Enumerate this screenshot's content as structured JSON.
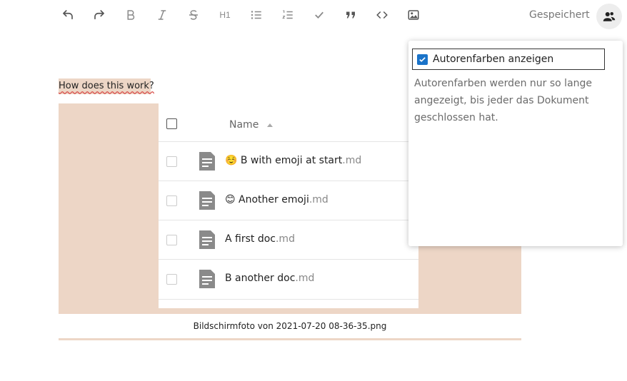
{
  "toolbar": {
    "heading_label": "H1",
    "status": "Gespeichert",
    "icons": [
      "undo-icon",
      "redo-icon",
      "bold-icon",
      "italic-icon",
      "strikethrough-icon",
      "heading-icon",
      "bullet-list-icon",
      "ordered-list-icon",
      "checkmark-icon",
      "quote-icon",
      "code-icon",
      "image-icon",
      "users-icon"
    ]
  },
  "document": {
    "link_text": "How does this work?",
    "image_caption": "Bildschirmfoto von 2021-07-20 08-36-35.png",
    "file_table": {
      "column_name": "Name",
      "rows": [
        {
          "name": "☺️ B with emoji at start",
          "ext": ".md"
        },
        {
          "name": "😊 Another emoji",
          "ext": ".md"
        },
        {
          "name": "A first doc",
          "ext": ".md"
        },
        {
          "name": "B another doc",
          "ext": ".md"
        }
      ]
    }
  },
  "popover": {
    "checkbox_label": "Autorenfarben anzeigen",
    "checked": true,
    "description": "Autorenfarben werden nur so lange angezeigt, bis jeder das Dokument geschlossen hat."
  },
  "colors": {
    "author_highlight": "#edd6c6",
    "checkbox_accent": "#1a73c9"
  }
}
